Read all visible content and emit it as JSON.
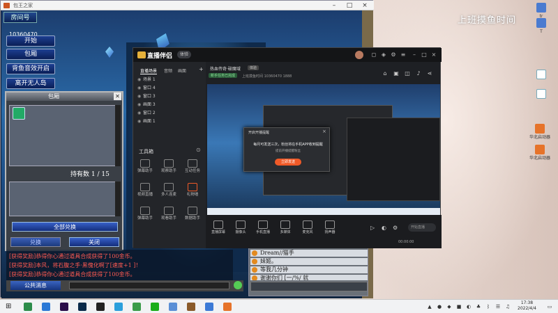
{
  "desktop": {
    "overlay_text": "上班摸鱼时间",
    "icons": [
      {
        "label": "tr",
        "color": "#4a7bd0"
      },
      {
        "label": "T",
        "color": "#4a7bd0"
      },
      {
        "label": "",
        "color": "#7ab"
      },
      {
        "label": "",
        "color": "#7ab"
      },
      {
        "label": "华北启动器",
        "color": "#e6732a"
      },
      {
        "label": "华北启动器",
        "color": "#e6732a"
      }
    ]
  },
  "game": {
    "window_title": "包王之家",
    "room_label": "房间号",
    "room_number": "10360470",
    "menu_buttons": [
      "开始",
      "包厢",
      "背鱼音效开启",
      "离开无人岛"
    ],
    "bag": {
      "title": "包厢",
      "count_text": "持有数 1 / 15",
      "exchange_all": "全部兑换",
      "confirm": "兑换",
      "close": "关闭"
    },
    "chat_lines": [
      "[获得奖励]恭得你心通过道具合成获得了100金币。",
      "[获得奖励]本风，将石腹之手·黑傀化啊了[速度+1 ]！",
      "[获得奖励]恭得你心通过道具合成获得了100金币。"
    ],
    "public_msg_button": "公共消息",
    "voice_rows": [
      "Dream//猫手",
      "妹姬。",
      "等我几分钟",
      "谢谢你们 [一/%/ 就"
    ]
  },
  "streamer": {
    "app_title": "直播伴侣",
    "app_tag": "体验",
    "scene_tabs": [
      "直播场景",
      "音频",
      "画面"
    ],
    "sources": [
      "场景 1",
      "窗口 4",
      "窗口 3",
      "画面 3",
      "窗口 2",
      "画面 1"
    ],
    "tools_title": "工具箱",
    "tools": [
      {
        "label": "弹幕助手"
      },
      {
        "label": "观察助手"
      },
      {
        "label": "互动任务"
      },
      {
        "label": "视频直播"
      },
      {
        "label": "多人连麦"
      },
      {
        "label": "礼物墙"
      },
      {
        "label": "弹幕助手"
      },
      {
        "label": "观看助手"
      },
      {
        "label": "数据助手"
      }
    ],
    "room_name": "热血传奇·破魔域",
    "room_tag": "体验",
    "badge": "新手任务已完成",
    "meta": "上班摸鱼时间  10360470  1888",
    "popup": {
      "title": "开启开播提醒",
      "message": "每月可发送三次，粉丝将在手机APP收到提醒",
      "sub": "提前开播提醒粉丝",
      "button": "立即发送"
    },
    "bottom_tools": [
      "直播屏幕",
      "摄像头",
      "手机直播",
      "多媒体",
      "麦克风",
      "扬声器"
    ],
    "live_input": "开始直播",
    "status": "00:00:00"
  },
  "taskbar": {
    "time": "17:38",
    "date": "2022/4/4",
    "apps": [
      {
        "name": "search-app",
        "color": "#2c8c4a"
      },
      {
        "name": "tablet-app",
        "color": "#2b79d6"
      },
      {
        "name": "premiere-app",
        "color": "#2a0d4a"
      },
      {
        "name": "photoshop-app",
        "color": "#0a2a4a"
      },
      {
        "name": "qq-app",
        "color": "#222"
      },
      {
        "name": "edge-app",
        "color": "#2a9fdc"
      },
      {
        "name": "chrome-app",
        "color": "#3a9b49"
      },
      {
        "name": "wechat-app",
        "color": "#1aad19"
      },
      {
        "name": "explorer-app",
        "color": "#5b8fd6"
      },
      {
        "name": "game-app",
        "color": "#8a5a2a"
      },
      {
        "name": "streamer-app",
        "color": "#3c7ad6"
      },
      {
        "name": "launcher-app",
        "color": "#e6732a"
      }
    ]
  }
}
